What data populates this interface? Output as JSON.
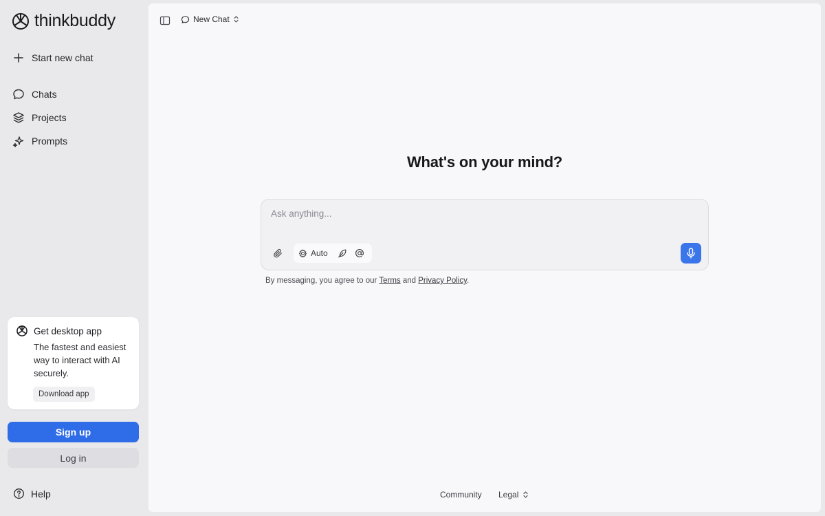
{
  "app": {
    "name": "thinkbuddy"
  },
  "sidebar": {
    "new_chat_label": "Start new chat",
    "items": [
      {
        "label": "Chats",
        "icon": "chat-bubble-icon"
      },
      {
        "label": "Projects",
        "icon": "layers-icon"
      },
      {
        "label": "Prompts",
        "icon": "sparkles-icon"
      }
    ],
    "promo": {
      "title": "Get desktop app",
      "description": "The fastest and easiest way to interact with AI securely.",
      "button_label": "Download app"
    },
    "signup_label": "Sign up",
    "login_label": "Log in",
    "help_label": "Help"
  },
  "topbar": {
    "chat_title": "New Chat"
  },
  "main": {
    "headline": "What's on your mind?",
    "composer": {
      "placeholder": "Ask anything...",
      "model_label": "Auto"
    },
    "disclaimer": {
      "prefix": "By messaging, you agree to our ",
      "terms": "Terms",
      "and": " and ",
      "privacy": "Privacy Policy",
      "suffix": "."
    }
  },
  "footer": {
    "community": "Community",
    "legal": "Legal"
  },
  "colors": {
    "accent": "#2f6de8",
    "mic": "#3b75ea",
    "sidebar_bg": "#e9e9ec",
    "main_bg": "#f8f8fa"
  }
}
